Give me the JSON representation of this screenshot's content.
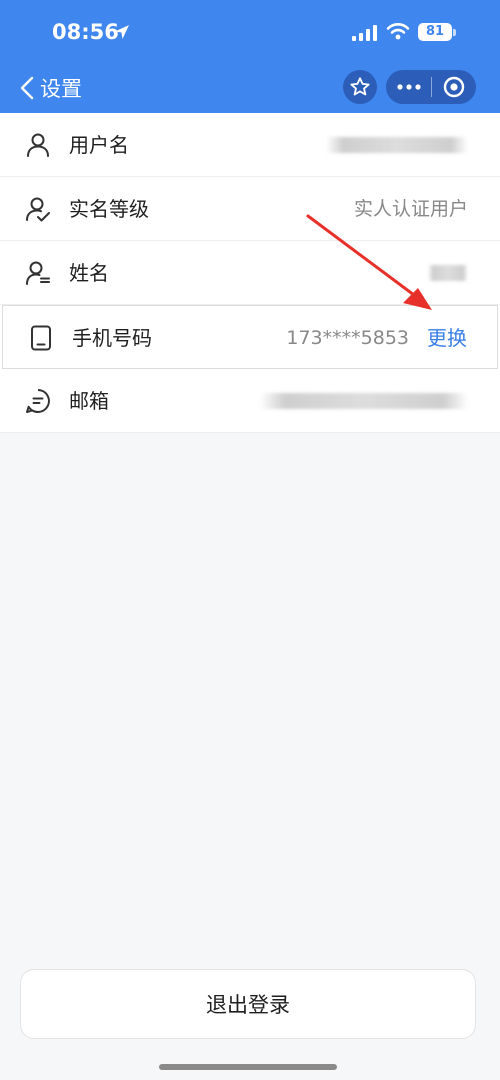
{
  "status_bar": {
    "time": "08:56",
    "battery": "81"
  },
  "nav": {
    "back_label": "设置",
    "icons": {
      "star": "star-icon",
      "more": "more-dots-icon",
      "close": "target-close-icon"
    }
  },
  "rows": [
    {
      "label": "用户名",
      "value": "",
      "icon": "user-icon",
      "value_blurred": true
    },
    {
      "label": "实名等级",
      "value": "实人认证用户",
      "icon": "user-check-icon",
      "value_blurred": false
    },
    {
      "label": "姓名",
      "value": "",
      "icon": "user-list-icon",
      "value_blurred": true
    },
    {
      "label": "手机号码",
      "value": "173****5853",
      "icon": "phone-icon",
      "action": "更换",
      "value_blurred": false
    },
    {
      "label": "邮箱",
      "value": "",
      "icon": "message-icon",
      "value_blurred": true
    }
  ],
  "logout_label": "退出登录",
  "colors": {
    "header_bg": "#3f86ee",
    "link": "#3a7fe6",
    "annotation_arrow": "#e8302a"
  }
}
